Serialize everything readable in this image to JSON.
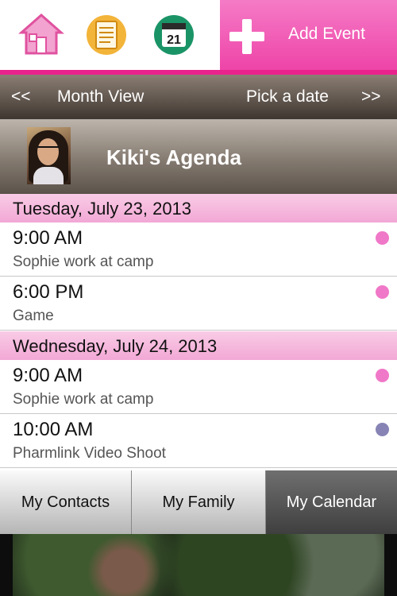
{
  "toolbar": {
    "icons": [
      "home-icon",
      "notes-icon",
      "calendar-icon"
    ],
    "calendar_icon_day": "21",
    "add_event_label": "Add Event",
    "accent": "#ee44a8"
  },
  "month_bar": {
    "prev": "<<",
    "month_view": "Month View",
    "pick_date": "Pick a date",
    "next": ">>"
  },
  "agenda": {
    "title": "Kiki's Agenda",
    "days": [
      {
        "date": "Tuesday, July 23, 2013",
        "events": [
          {
            "time": "9:00 AM",
            "title": "Sophie work at camp",
            "color": "#f078c8"
          },
          {
            "time": "6:00 PM",
            "title": "Game",
            "color": "#f078c8"
          }
        ]
      },
      {
        "date": "Wednesday, July 24, 2013",
        "events": [
          {
            "time": "9:00 AM",
            "title": "Sophie work at camp",
            "color": "#f078c8"
          },
          {
            "time": "10:00 AM",
            "title": "Pharmlink Video Shoot",
            "color": "#8784b5"
          }
        ]
      }
    ]
  },
  "tabs": [
    {
      "label": "My Contacts",
      "active": false
    },
    {
      "label": "My Family",
      "active": false
    },
    {
      "label": "My Calendar",
      "active": true
    }
  ]
}
